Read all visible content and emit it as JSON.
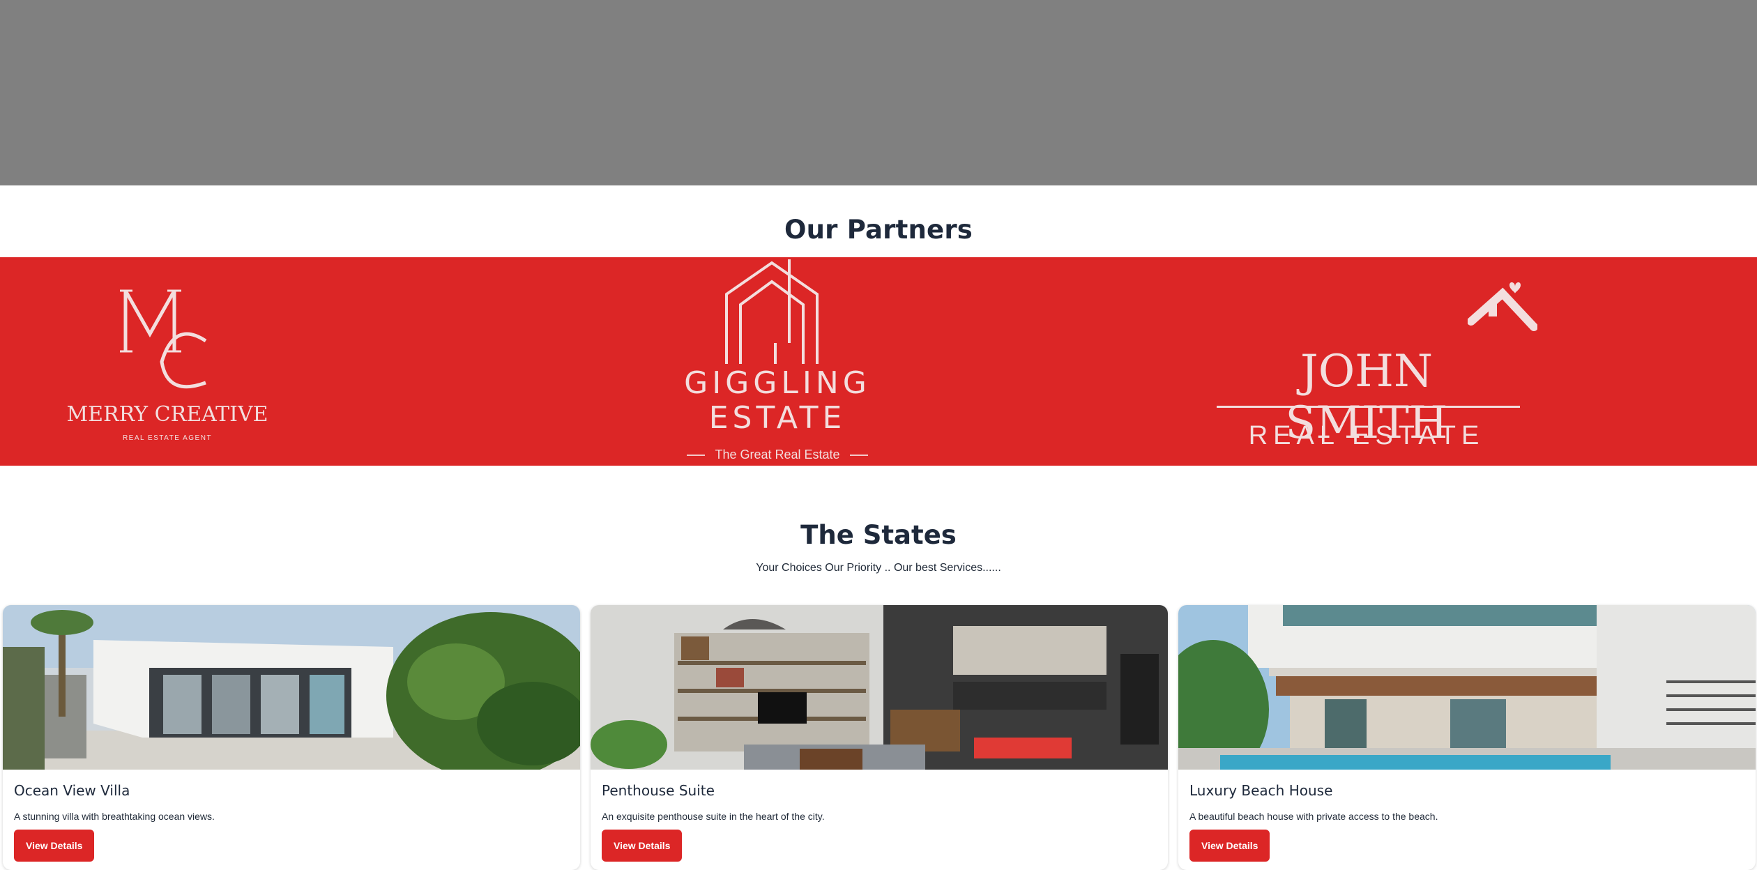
{
  "partners": {
    "heading": "Our Partners",
    "band_color": "#dc2626",
    "logos": [
      {
        "name": "MERRY CREATIVE",
        "tagline": "REAL ESTATE AGENT",
        "monogram": "MC"
      },
      {
        "name_line1": "GIGGLING",
        "name_line2": "ESTATE",
        "tagline": "The Great Real Estate"
      },
      {
        "name": "JOHN SMITH",
        "tagline": "REAL ESTATE"
      }
    ]
  },
  "states": {
    "heading": "The States",
    "subtitle": "Your Choices Our Priority .. Our best Services......",
    "cards": [
      {
        "title": "Ocean View Villa",
        "description": "A stunning villa with breathtaking ocean views.",
        "button": "View Details"
      },
      {
        "title": "Penthouse Suite",
        "description": "An exquisite penthouse suite in the heart of the city.",
        "button": "View Details"
      },
      {
        "title": "Luxury Beach House",
        "description": "A beautiful beach house with private access to the beach.",
        "button": "View Details"
      }
    ]
  },
  "colors": {
    "accent": "#dc2626",
    "hero": "#808080",
    "heading": "#1e293b"
  }
}
